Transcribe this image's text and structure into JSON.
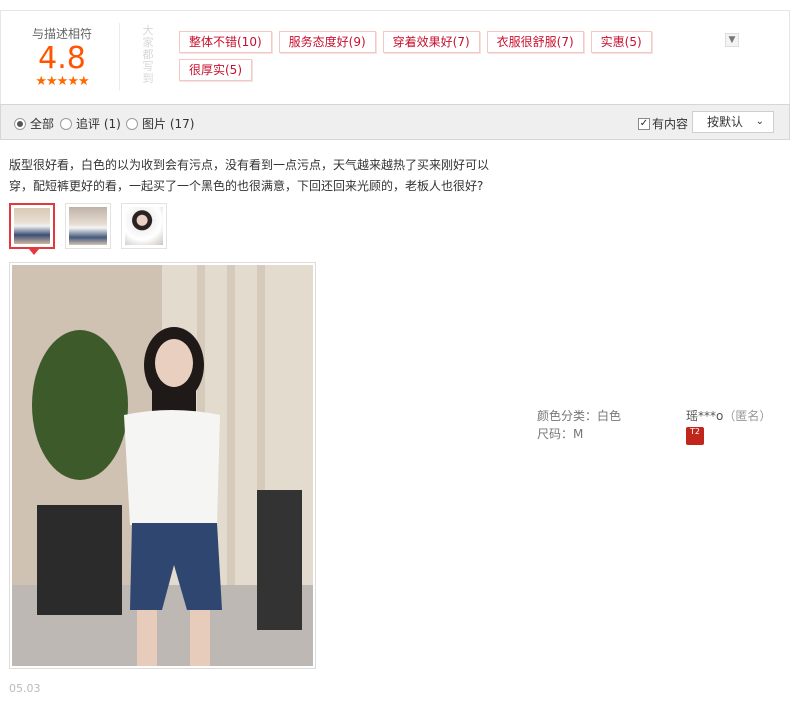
{
  "rating": {
    "title": "与描述相符",
    "score": "4.8",
    "stars": "★★★★★",
    "vertical_note": "大家都写到"
  },
  "tags": [
    "整体不错(10)",
    "服务态度好(9)",
    "穿着效果好(7)",
    "衣服很舒服(7)",
    "实惠(5)",
    "很厚实(5)"
  ],
  "filter": {
    "all": "全部",
    "append": "追评 (1)",
    "pictures": "图片 (17)",
    "has_content": "有内容",
    "sort": "按默认"
  },
  "review": {
    "text": "版型很好看，白色的以为收到会有污点，没有看到一点污点，天气越来越热了买来刚好可以穿，配短裤更好的看，一起买了一个黑色的也很满意，下回还回来光顾的，老板人也很好?",
    "sku_color": "颜色分类：白色",
    "sku_size": "尺码：M",
    "user": "瑶***o",
    "anonymous": "（匿名）",
    "badge": "T2",
    "date": "05.03"
  },
  "colors": {
    "accent": "#ff5500",
    "tag_text": "#c8102e",
    "active_border": "#e4393c"
  }
}
